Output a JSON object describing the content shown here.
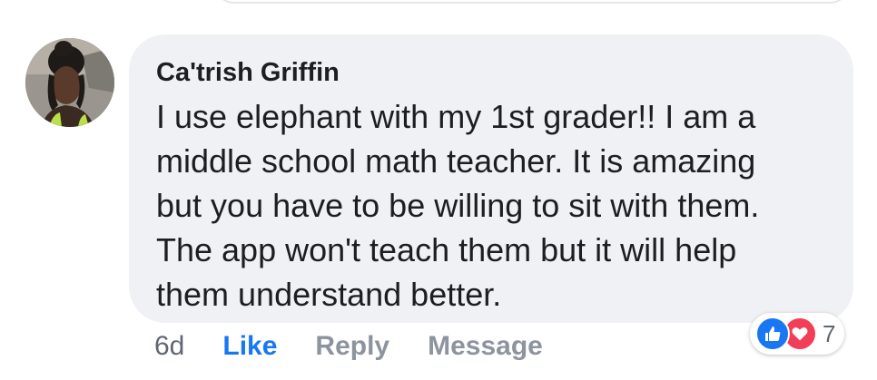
{
  "comment": {
    "author": "Ca'trish Griffin",
    "text": "I use elephant with my 1st grader!! I am a\nmiddle school math teacher. It is amazing\nbut you have to be willing to sit with them.\nThe app won't teach them but it will help\nthem understand better."
  },
  "actions": {
    "timestamp": "6d",
    "like": "Like",
    "reply": "Reply",
    "message": "Message"
  },
  "reactions": {
    "icons": [
      "thumbs-up-icon",
      "heart-icon"
    ],
    "count": "7"
  },
  "colors": {
    "bubble": "#f0f1f4",
    "like_blue": "#1877f2",
    "love_red": "#f33e58",
    "muted_text": "#8d949e"
  }
}
